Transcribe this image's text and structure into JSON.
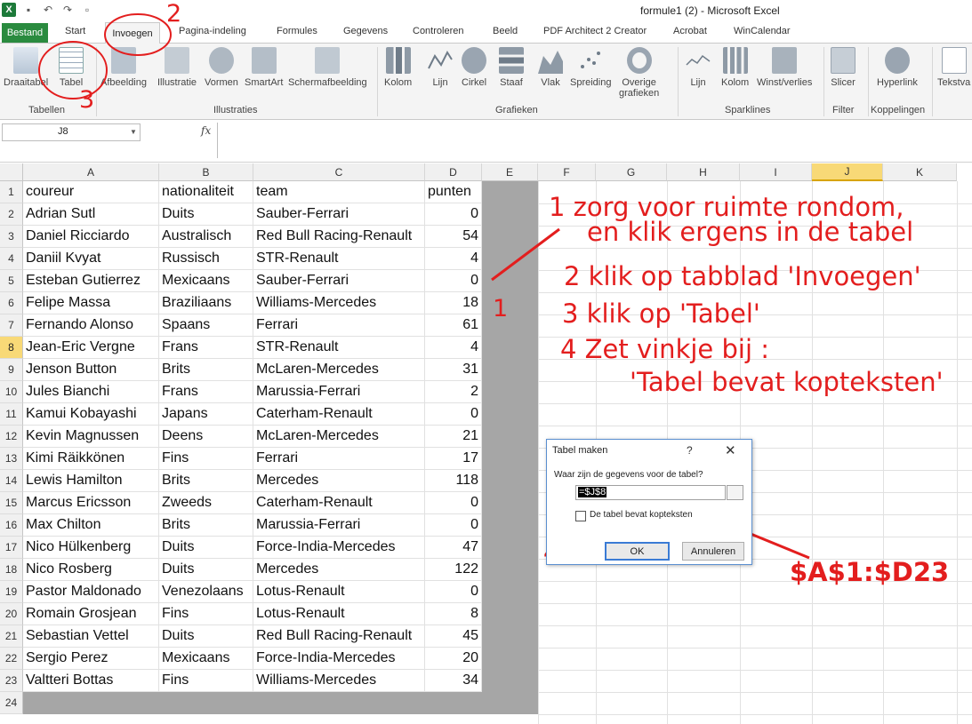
{
  "window": {
    "title": "formule1 (2)  -  Microsoft Excel"
  },
  "tabs": [
    "Start",
    "Pagina-indeling",
    "Formules",
    "Gegevens",
    "Controleren",
    "Beeld",
    "PDF Architect 2 Creator",
    "Acrobat",
    "WinCalendar"
  ],
  "file_tab": "Bestand",
  "active_tab": "Invoegen",
  "ribbon": {
    "buttons": [
      {
        "label": "Draaitabel",
        "icon": "pivottable-icon"
      },
      {
        "label": "Tabel",
        "icon": "table-icon"
      },
      {
        "label": "Afbeelding",
        "icon": "picture-icon"
      },
      {
        "label": "Illustratie",
        "icon": "clipart-icon"
      },
      {
        "label": "Vormen",
        "icon": "shapes-icon"
      },
      {
        "label": "SmartArt",
        "icon": "smartart-icon"
      },
      {
        "label": "Schermafbeelding",
        "icon": "screenshot-icon"
      },
      {
        "label": "Kolom",
        "icon": "column-chart-icon"
      },
      {
        "label": "Lijn",
        "icon": "line-chart-icon"
      },
      {
        "label": "Cirkel",
        "icon": "pie-chart-icon"
      },
      {
        "label": "Staaf",
        "icon": "bar-chart-icon"
      },
      {
        "label": "Vlak",
        "icon": "area-chart-icon"
      },
      {
        "label": "Spreiding",
        "icon": "scatter-chart-icon"
      },
      {
        "label": "Overige",
        "label2": "grafieken",
        "icon": "other-charts-icon"
      },
      {
        "label": "Lijn",
        "icon": "sparkline-line-icon"
      },
      {
        "label": "Kolom",
        "icon": "sparkline-column-icon"
      },
      {
        "label": "Winst/verlies",
        "icon": "sparkline-winloss-icon"
      },
      {
        "label": "Slicer",
        "icon": "slicer-icon"
      },
      {
        "label": "Hyperlink",
        "icon": "hyperlink-icon"
      },
      {
        "label": "Tekstva",
        "icon": "textbox-icon"
      }
    ],
    "groups": [
      "Tabellen",
      "Illustraties",
      "Grafieken",
      "Sparklines",
      "Filter",
      "Koppelingen"
    ]
  },
  "formula_bar": {
    "name_box": "J8",
    "fx": "fx",
    "content": ""
  },
  "columns": [
    "A",
    "B",
    "C",
    "D",
    "E",
    "F",
    "G",
    "H",
    "I",
    "J",
    "K"
  ],
  "rows": [
    [
      "coureur",
      "nationaliteit",
      "team",
      "punten"
    ],
    [
      "Adrian Sutl",
      "Duits",
      "Sauber-Ferrari",
      "0"
    ],
    [
      "Daniel Ricciardo",
      "Australisch",
      "Red Bull Racing-Renault",
      "54"
    ],
    [
      "Daniil Kvyat",
      "Russisch",
      "STR-Renault",
      "4"
    ],
    [
      "Esteban Gutierrez",
      "Mexicaans",
      "Sauber-Ferrari",
      "0"
    ],
    [
      "Felipe Massa",
      "Braziliaans",
      "Williams-Mercedes",
      "18"
    ],
    [
      "Fernando Alonso",
      "Spaans",
      "Ferrari",
      "61"
    ],
    [
      "Jean-Eric Vergne",
      "Frans",
      "STR-Renault",
      "4"
    ],
    [
      "Jenson Button",
      "Brits",
      "McLaren-Mercedes",
      "31"
    ],
    [
      "Jules Bianchi",
      "Frans",
      "Marussia-Ferrari",
      "2"
    ],
    [
      "Kamui Kobayashi",
      "Japans",
      "Caterham-Renault",
      "0"
    ],
    [
      "Kevin Magnussen",
      "Deens",
      "McLaren-Mercedes",
      "21"
    ],
    [
      "Kimi Räikkönen",
      "Fins",
      "Ferrari",
      "17"
    ],
    [
      "Lewis Hamilton",
      "Brits",
      "Mercedes",
      "118"
    ],
    [
      "Marcus Ericsson",
      "Zweeds",
      "Caterham-Renault",
      "0"
    ],
    [
      "Max Chilton",
      "Brits",
      "Marussia-Ferrari",
      "0"
    ],
    [
      "Nico Hülkenberg",
      "Duits",
      "Force-India-Mercedes",
      "47"
    ],
    [
      "Nico Rosberg",
      "Duits",
      "Mercedes",
      "122"
    ],
    [
      "Pastor Maldonado",
      "Venezolaans",
      "Lotus-Renault",
      "0"
    ],
    [
      "Romain Grosjean",
      "Fins",
      "Lotus-Renault",
      "8"
    ],
    [
      "Sebastian Vettel",
      "Duits",
      "Red Bull Racing-Renault",
      "45"
    ],
    [
      "Sergio Perez",
      "Mexicaans",
      "Force-India-Mercedes",
      "20"
    ],
    [
      "Valtteri Bottas",
      "Fins",
      "Williams-Mercedes",
      "34"
    ]
  ],
  "annotations": {
    "line1a": "1 zorg voor ruimte rondom,",
    "line1b": "en klik ergens in de tabel",
    "line2": "2 klik op tabblad 'Invoegen'",
    "line3": "3 klik op  'Tabel'",
    "line4a": "4 Zet vinkje bij :",
    "line4b": "'Tabel bevat kopteksten'",
    "range": "$A$1:$D23",
    "num1": "1",
    "num2": "2",
    "num3": "3",
    "num4": "4",
    "color": "#e31e1e"
  },
  "dialog": {
    "title": "Tabel maken",
    "help": "?",
    "close": "✕",
    "prompt": "Waar zijn de gegevens voor de tabel?",
    "range_value": "=$J$8",
    "checkbox_label": "De tabel bevat kopteksten",
    "checked": false,
    "ok": "OK",
    "cancel": "Annuleren"
  }
}
